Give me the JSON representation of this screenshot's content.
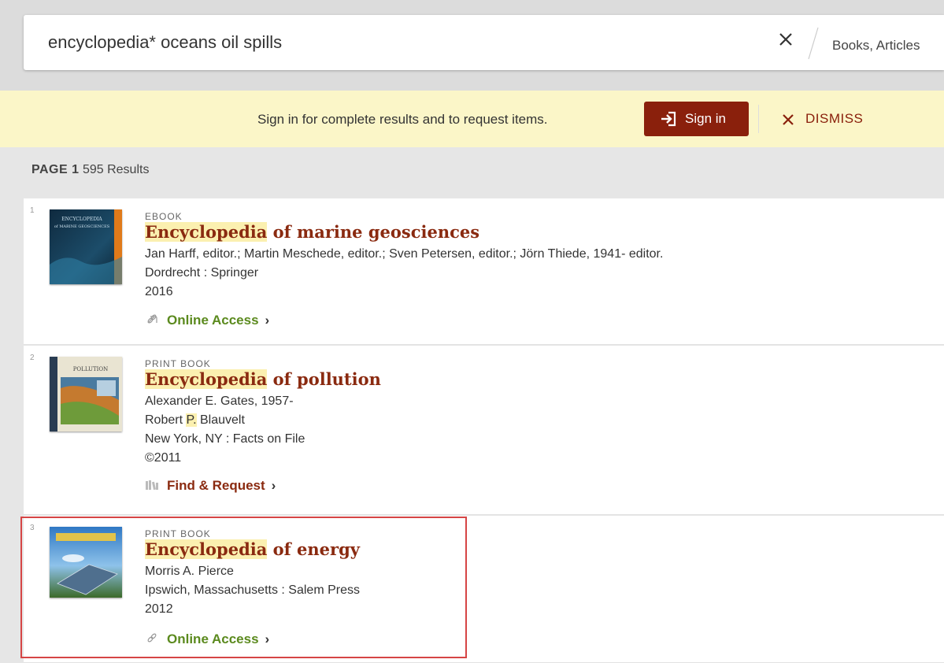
{
  "search": {
    "query": "encyclopedia* oceans oil spills",
    "scope": "Books, Articles"
  },
  "banner": {
    "message": "Sign in for complete results and to request items.",
    "signin_label": "Sign in",
    "dismiss_label": "DISMISS"
  },
  "results_header": {
    "page_label": "PAGE 1",
    "count": "595 Results"
  },
  "results": [
    {
      "index": "1",
      "type": "EBOOK",
      "title_highlight": "Encyclopedia",
      "title_rest": " of marine geosciences",
      "lines": [
        "Jan Harff, editor.; Martin Meschede, editor.; Sven Petersen, editor.; Jörn Thiede, 1941- editor.",
        "Dordrecht : Springer",
        "2016"
      ],
      "access_label": "Online Access",
      "access_icon": "link-icon",
      "cover_text": "ENCYCLOPEDIA of MARINE GEOSCIENCES"
    },
    {
      "index": "2",
      "type": "PRINT BOOK",
      "title_highlight": "Encyclopedia",
      "title_rest": " of pollution",
      "lines": [
        "Alexander E. Gates, 1957-",
        "Robert ",
        "P.",
        " Blauvelt",
        "New York, NY : Facts on File",
        "©2011"
      ],
      "access_label": "Find & Request",
      "access_icon": "book-icon",
      "cover_text": "POLLUTION"
    },
    {
      "index": "3",
      "type": "PRINT BOOK",
      "title_highlight": "Encyclopedia",
      "title_rest": " of energy",
      "lines": [
        "Morris A. Pierce",
        "Ipswich, Massachusetts : Salem Press",
        "2012"
      ],
      "access_label": "Online Access",
      "access_icon": "link-icon"
    }
  ],
  "colors": {
    "brand": "#8a200c",
    "title": "#8a2a10",
    "online_access": "#5b8a1e",
    "banner_bg": "#fbf6c8",
    "highlight": "#fbf0b0",
    "selection_outline": "#d64545"
  }
}
